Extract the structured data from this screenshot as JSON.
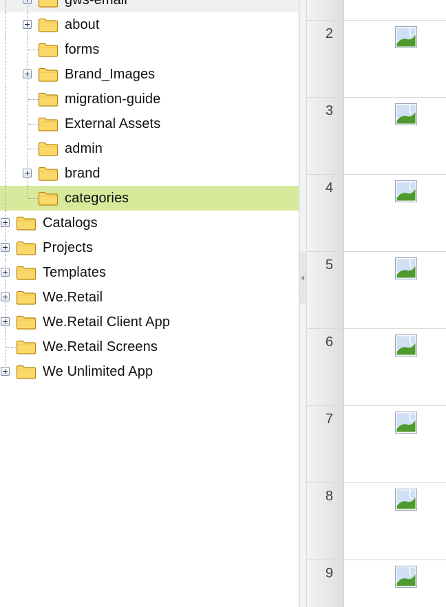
{
  "tree": {
    "nested_items": [
      {
        "label": "gws-email",
        "expandable": true,
        "clipped_top": true
      },
      {
        "label": "about",
        "expandable": true
      },
      {
        "label": "forms",
        "expandable": false
      },
      {
        "label": "Brand_Images",
        "expandable": true
      },
      {
        "label": "migration-guide",
        "expandable": false
      },
      {
        "label": "External Assets",
        "expandable": false
      },
      {
        "label": "admin",
        "expandable": false
      },
      {
        "label": "brand",
        "expandable": true
      },
      {
        "label": "categories",
        "expandable": false,
        "selected": true
      }
    ],
    "root_items": [
      {
        "label": "Catalogs",
        "expandable": true
      },
      {
        "label": "Projects",
        "expandable": true
      },
      {
        "label": "Templates",
        "expandable": true
      },
      {
        "label": "We.Retail",
        "expandable": true
      },
      {
        "label": "We.Retail Client App",
        "expandable": true
      },
      {
        "label": "We.Retail Screens",
        "expandable": false
      },
      {
        "label": "We Unlimited App",
        "expandable": true
      }
    ]
  },
  "grid": {
    "rows": [
      {
        "number": "",
        "clipped_top": true
      },
      {
        "number": "2"
      },
      {
        "number": "3"
      },
      {
        "number": "4"
      },
      {
        "number": "5"
      },
      {
        "number": "6"
      },
      {
        "number": "7"
      },
      {
        "number": "8"
      },
      {
        "number": "9"
      }
    ],
    "thumbnail_icon": "broken-image-icon"
  },
  "colors": {
    "selected_row": "#d7ea9c",
    "folder_fill": "#fbd86a",
    "folder_stroke": "#b8860b"
  }
}
